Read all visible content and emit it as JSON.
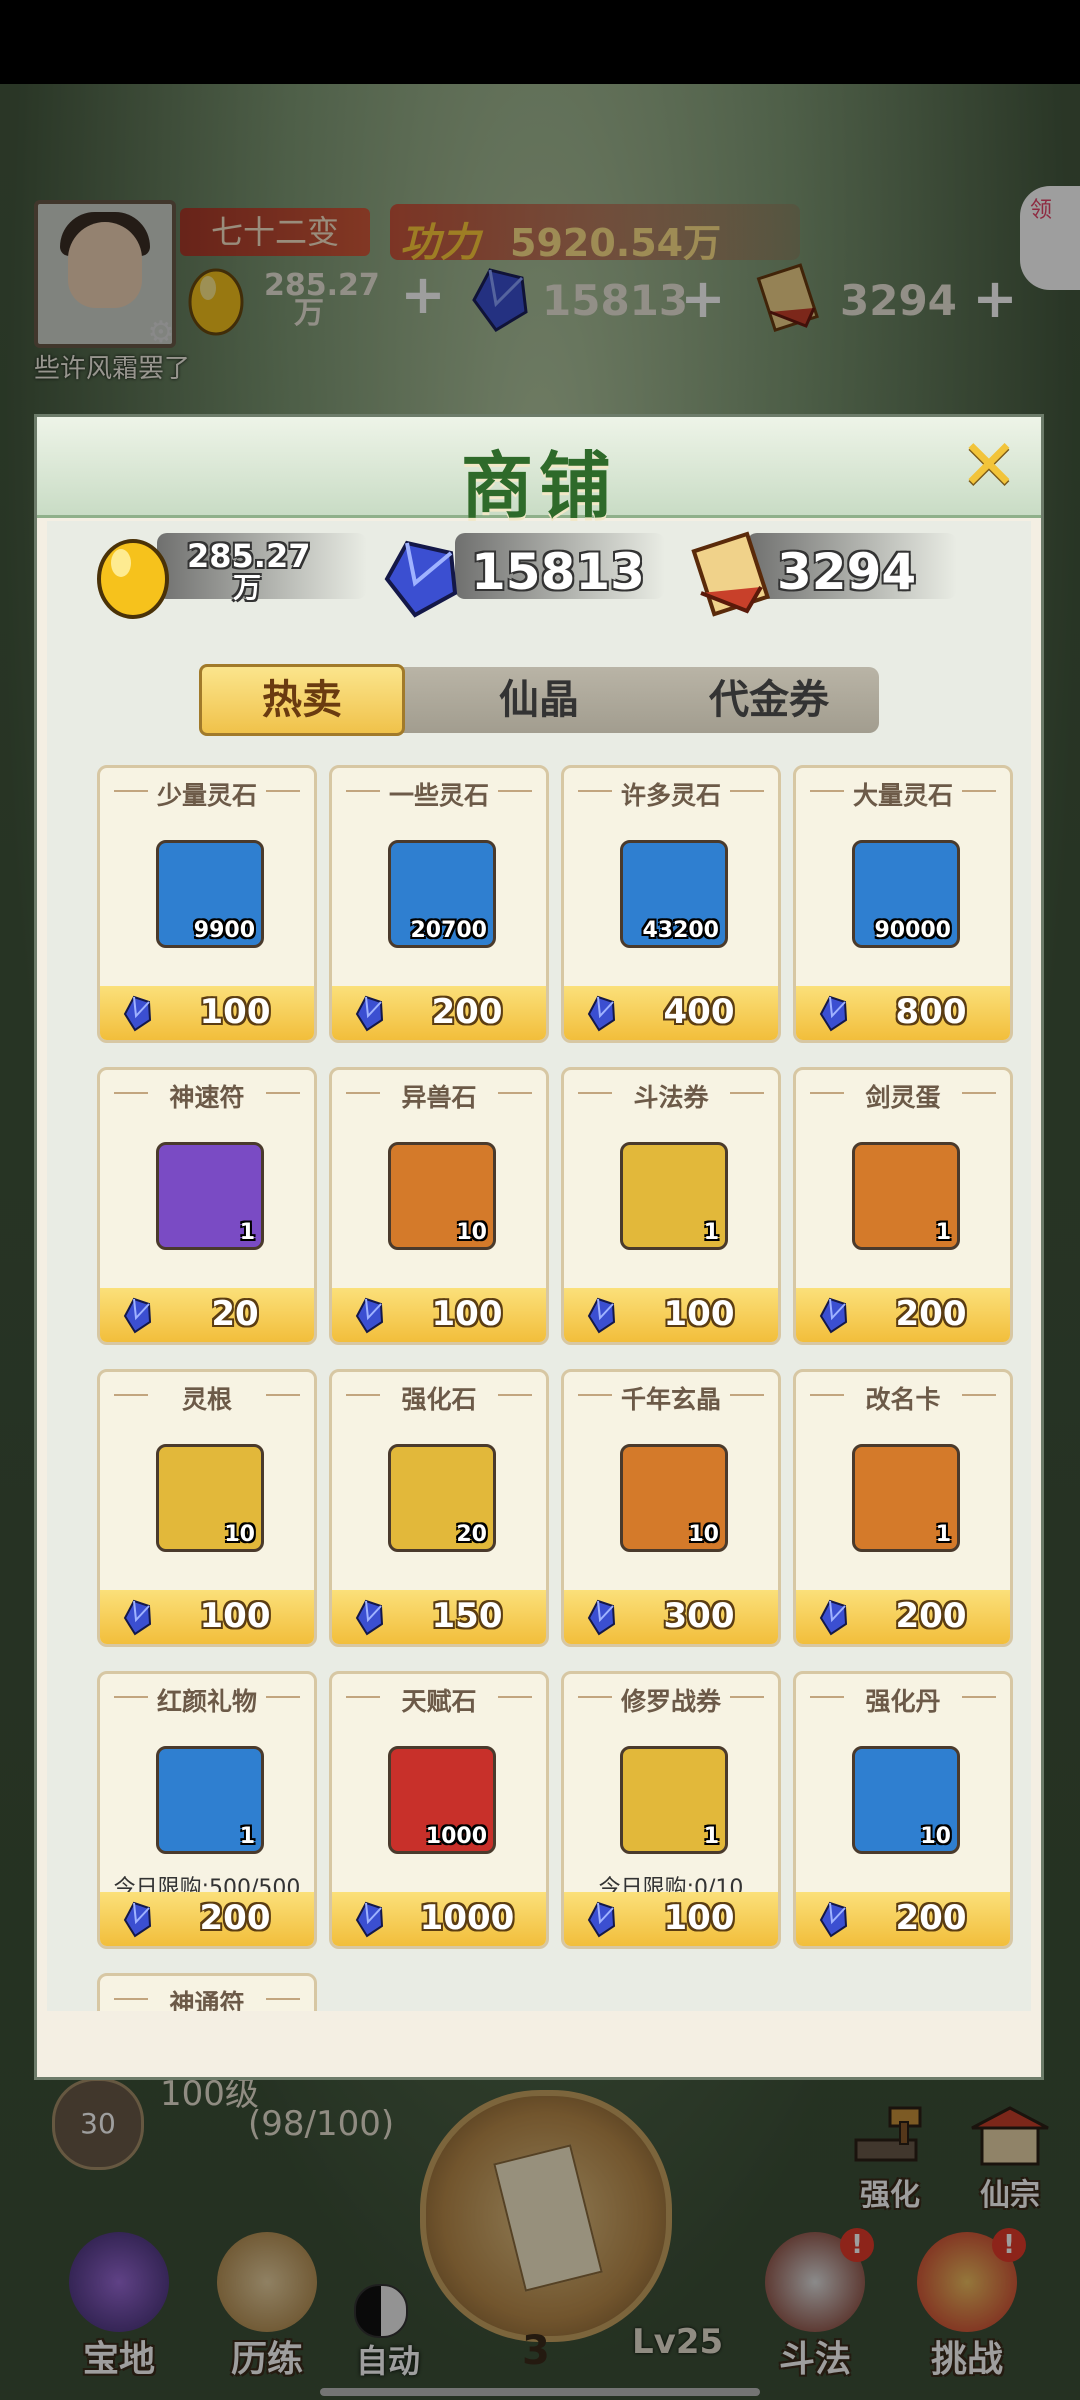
{
  "hud": {
    "player_name": "些许风霜罢了",
    "title": "七十二变",
    "power_label": "功力",
    "power_value": "5920.54万",
    "gold_value": "285.27",
    "gold_unit": "万",
    "gem_value": "15813",
    "voucher_value": "3294",
    "corner_badge": "领"
  },
  "shop": {
    "title": "商铺",
    "close_icon": "close-icon",
    "currencies": {
      "gold_value": "285.27",
      "gold_unit": "万",
      "gem_value": "15813",
      "voucher_value": "3294"
    },
    "tabs": [
      {
        "label": "热卖",
        "active": true
      },
      {
        "label": "仙晶",
        "active": false
      },
      {
        "label": "代金券",
        "active": false
      }
    ],
    "items": [
      {
        "name": "少量灵石",
        "count": "9900",
        "price": "100",
        "icon": "spirit-stone-bag-icon",
        "bg": "#2f7fd0"
      },
      {
        "name": "一些灵石",
        "count": "20700",
        "price": "200",
        "icon": "spirit-stone-bag-icon",
        "bg": "#2f7fd0"
      },
      {
        "name": "许多灵石",
        "count": "43200",
        "price": "400",
        "icon": "spirit-stone-bag-icon",
        "bg": "#2f7fd0"
      },
      {
        "name": "大量灵石",
        "count": "90000",
        "price": "800",
        "icon": "spirit-stone-bag-icon",
        "bg": "#2f7fd0"
      },
      {
        "name": "神速符",
        "count": "1",
        "price": "20",
        "icon": "talisman-scroll-icon",
        "bg": "#7a4bc4"
      },
      {
        "name": "异兽石",
        "count": "10",
        "price": "100",
        "icon": "blue-flame-stone-icon",
        "bg": "#d47a2a"
      },
      {
        "name": "斗法券",
        "count": "1",
        "price": "100",
        "icon": "battle-ticket-scroll-icon",
        "bg": "#e2b83a"
      },
      {
        "name": "剑灵蛋",
        "count": "1",
        "price": "200",
        "icon": "sword-spirit-egg-icon",
        "bg": "#d47a2a"
      },
      {
        "name": "灵根",
        "count": "10",
        "price": "100",
        "icon": "mushroom-root-icon",
        "bg": "#e2b83a"
      },
      {
        "name": "强化石",
        "count": "20",
        "price": "150",
        "icon": "enhance-stone-icon",
        "bg": "#e2b83a"
      },
      {
        "name": "千年玄晶",
        "count": "10",
        "price": "300",
        "icon": "red-crystal-icon",
        "bg": "#d47a2a"
      },
      {
        "name": "改名卡",
        "count": "1",
        "price": "200",
        "icon": "rename-card-icon",
        "bg": "#d47a2a"
      },
      {
        "name": "红颜礼物",
        "count": "1",
        "price": "200",
        "icon": "gift-bag-icon",
        "bg": "#2f7fd0",
        "limit": "今日限购:500/500"
      },
      {
        "name": "天赋石",
        "count": "1000",
        "price": "1000",
        "icon": "green-gem-icon",
        "bg": "#c8302a"
      },
      {
        "name": "修罗战券",
        "count": "1",
        "price": "100",
        "icon": "war-ticket-icon",
        "bg": "#e2b83a",
        "limit": "今日限购:0/10"
      },
      {
        "name": "强化丹",
        "count": "10",
        "price": "200",
        "icon": "enhance-pill-icon",
        "bg": "#2f7fd0"
      },
      {
        "name": "神通符",
        "count": "",
        "price": "",
        "icon": "talisman-icon",
        "bg": "#7a4bc4"
      }
    ]
  },
  "bottom": {
    "level_text": "100级",
    "level_badge": "30",
    "progress_text": "(98/100)",
    "auto_label": "自动",
    "stage_number": "3",
    "lv_label": "Lv25",
    "nav": [
      {
        "label": "宝地",
        "icon": "treasure-land-icon",
        "alert": false
      },
      {
        "label": "历练",
        "icon": "training-icon",
        "alert": false
      },
      {
        "label": "斗法",
        "icon": "battle-sword-icon",
        "alert": true
      },
      {
        "label": "挑战",
        "icon": "challenge-lion-icon",
        "alert": true
      }
    ],
    "side": [
      {
        "label": "强化",
        "icon": "anvil-hammer-icon"
      },
      {
        "label": "仙宗",
        "icon": "sect-temple-icon"
      }
    ],
    "alert_mark": "!"
  },
  "colors": {
    "accent_gold": "#f2be3b",
    "title_green": "#2e6a2a",
    "gem_blue": "#3b4fd1"
  }
}
